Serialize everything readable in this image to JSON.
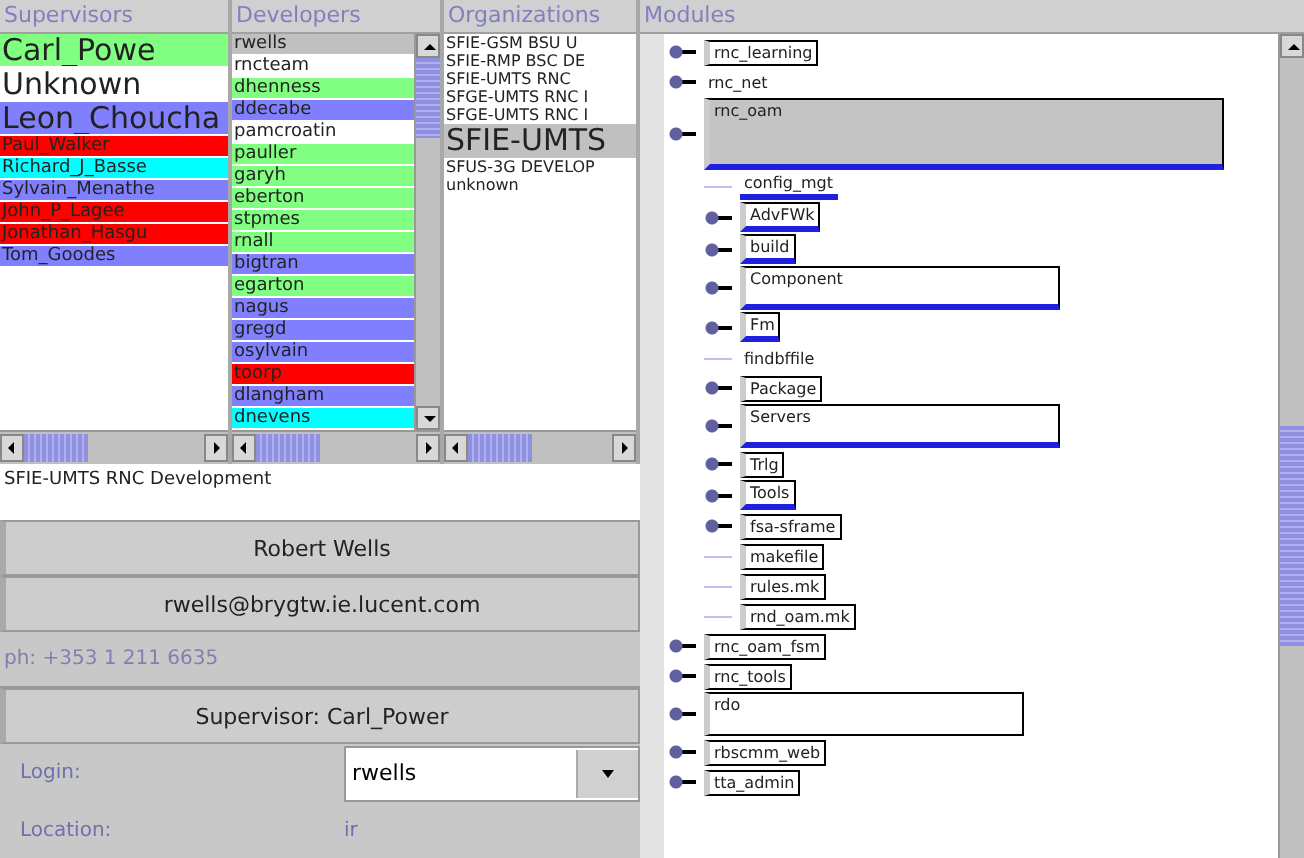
{
  "supervisors": {
    "title": "Supervisors",
    "items": [
      {
        "label": "Carl_Powe",
        "kind": "large",
        "color": "#80ff80",
        "selected": false
      },
      {
        "label": "Unknown",
        "kind": "large",
        "color": "#ffffff",
        "selected": false
      },
      {
        "label": "Leon_Choucha",
        "kind": "large",
        "color": "#8080ff",
        "selected": false
      },
      {
        "label": "Paul_Walker",
        "kind": "small",
        "color": "#ff0000",
        "selected": false
      },
      {
        "label": "Richard_J_Basse",
        "kind": "small",
        "color": "#00ffff",
        "selected": false
      },
      {
        "label": "Sylvain_Menathe",
        "kind": "small",
        "color": "#8080ff",
        "selected": false
      },
      {
        "label": "John_P_Lagee",
        "kind": "small",
        "color": "#ff0000",
        "selected": false
      },
      {
        "label": "Jonathan_Hasgu",
        "kind": "small",
        "color": "#ff0000",
        "selected": false
      },
      {
        "label": "Tom_Goodes",
        "kind": "small",
        "color": "#8080ff",
        "selected": false
      }
    ]
  },
  "developers": {
    "title": "Developers",
    "items": [
      {
        "label": "rwells",
        "selected": true
      },
      {
        "label": "rncteam",
        "color": "#ffffff",
        "selected": false
      },
      {
        "label": "dhenness",
        "color": "#80ff80",
        "selected": false
      },
      {
        "label": "ddecabe",
        "color": "#8080ff",
        "selected": false
      },
      {
        "label": "pamcroatin",
        "color": "#ffffff",
        "selected": false
      },
      {
        "label": "pauller",
        "color": "#80ff80",
        "selected": false
      },
      {
        "label": "garyh",
        "color": "#80ff80",
        "selected": false
      },
      {
        "label": "eberton",
        "color": "#80ff80",
        "selected": false
      },
      {
        "label": "stpmes",
        "color": "#80ff80",
        "selected": false
      },
      {
        "label": "rnall",
        "color": "#80ff80",
        "selected": false
      },
      {
        "label": "bigtran",
        "color": "#8080ff",
        "selected": false
      },
      {
        "label": "egarton",
        "color": "#80ff80",
        "selected": false
      },
      {
        "label": "nagus",
        "color": "#8080ff",
        "selected": false
      },
      {
        "label": "gregd",
        "color": "#8080ff",
        "selected": false
      },
      {
        "label": "osylvain",
        "color": "#8080ff",
        "selected": false
      },
      {
        "label": "toorp",
        "color": "#ff0000",
        "selected": false
      },
      {
        "label": "dlangham",
        "color": "#8080ff",
        "selected": false
      },
      {
        "label": "dnevens",
        "color": "#00ffff",
        "selected": false
      }
    ]
  },
  "organizations": {
    "title": "Organizations",
    "items": [
      {
        "label": "SFIE-GSM BSU U",
        "kind": "small",
        "selected": false
      },
      {
        "label": "SFIE-RMP BSC DE",
        "kind": "small",
        "selected": false
      },
      {
        "label": "SFIE-UMTS RNC",
        "kind": "small",
        "selected": false
      },
      {
        "label": "SFGE-UMTS RNC I",
        "kind": "small",
        "selected": false
      },
      {
        "label": "SFGE-UMTS RNC I",
        "kind": "small",
        "selected": false
      },
      {
        "label": "SFIE-UMTS",
        "kind": "large",
        "selected": true
      },
      {
        "label": "SFUS-3G DEVELOP",
        "kind": "small",
        "selected": false
      },
      {
        "label": "unknown",
        "kind": "small",
        "selected": false
      }
    ]
  },
  "details": {
    "organization": "SFIE-UMTS RNC Development",
    "name": "Robert Wells",
    "email": "rwells@brygtw.ie.lucent.com",
    "phone": "ph: +353 1 211 6635",
    "supervisor": "Supervisor: Carl_Power",
    "login_label": "Login:",
    "login_value": "rwells",
    "location_label": "Location:",
    "location_value": "ir"
  },
  "modules": {
    "title": "Modules",
    "items": [
      {
        "label": "rnc_learning",
        "kind": "branch",
        "boxed": true,
        "underlined": false,
        "expanded": false,
        "selected": false
      },
      {
        "label": "rnc_net",
        "kind": "branch",
        "boxed": false,
        "underlined": false,
        "expanded": false,
        "selected": false
      },
      {
        "label": "rnc_oam",
        "kind": "branch",
        "boxed": true,
        "underlined": true,
        "expanded": true,
        "selected": true,
        "children": [
          {
            "label": "config_mgt",
            "kind": "leaf",
            "boxed": false,
            "underlined": true,
            "expanded": false,
            "selected": false
          },
          {
            "label": "AdvFWk",
            "kind": "branch",
            "boxed": true,
            "underlined": true,
            "expanded": false,
            "selected": false
          },
          {
            "label": "build",
            "kind": "branch",
            "boxed": true,
            "underlined": true,
            "expanded": false,
            "selected": false
          },
          {
            "label": "Component",
            "kind": "branch",
            "boxed": true,
            "underlined": true,
            "expanded": true,
            "selected": false
          },
          {
            "label": "Fm",
            "kind": "branch",
            "boxed": true,
            "underlined": true,
            "expanded": false,
            "selected": false
          },
          {
            "label": "findbffile",
            "kind": "leaf",
            "boxed": false,
            "underlined": false,
            "expanded": false,
            "selected": false
          },
          {
            "label": "Package",
            "kind": "branch",
            "boxed": true,
            "underlined": false,
            "expanded": false,
            "selected": false
          },
          {
            "label": "Servers",
            "kind": "branch",
            "boxed": true,
            "underlined": true,
            "expanded": true,
            "selected": false
          },
          {
            "label": "Trlg",
            "kind": "branch",
            "boxed": true,
            "underlined": false,
            "expanded": false,
            "selected": false
          },
          {
            "label": "Tools",
            "kind": "branch",
            "boxed": true,
            "underlined": true,
            "expanded": false,
            "selected": false
          },
          {
            "label": "fsa-sframe",
            "kind": "branch",
            "boxed": true,
            "underlined": false,
            "expanded": false,
            "selected": false
          },
          {
            "label": "makefile",
            "kind": "leaf",
            "boxed": true,
            "underlined": false,
            "expanded": false,
            "selected": false
          },
          {
            "label": "rules.mk",
            "kind": "leaf",
            "boxed": true,
            "underlined": false,
            "expanded": false,
            "selected": false
          },
          {
            "label": "rnd_oam.mk",
            "kind": "leaf",
            "boxed": true,
            "underlined": false,
            "expanded": false,
            "selected": false
          }
        ]
      },
      {
        "label": "rnc_oam_fsm",
        "kind": "branch",
        "boxed": true,
        "underlined": false,
        "expanded": false,
        "selected": false
      },
      {
        "label": "rnc_tools",
        "kind": "branch",
        "boxed": true,
        "underlined": false,
        "expanded": false,
        "selected": false
      },
      {
        "label": "rdo",
        "kind": "branch",
        "boxed": true,
        "underlined": false,
        "expanded": true,
        "selected": false
      },
      {
        "label": "rbscmm_web",
        "kind": "branch",
        "boxed": true,
        "underlined": false,
        "expanded": false,
        "selected": false
      },
      {
        "label": "tta_admin",
        "kind": "branch",
        "boxed": true,
        "underlined": false,
        "expanded": false,
        "selected": false
      }
    ]
  }
}
